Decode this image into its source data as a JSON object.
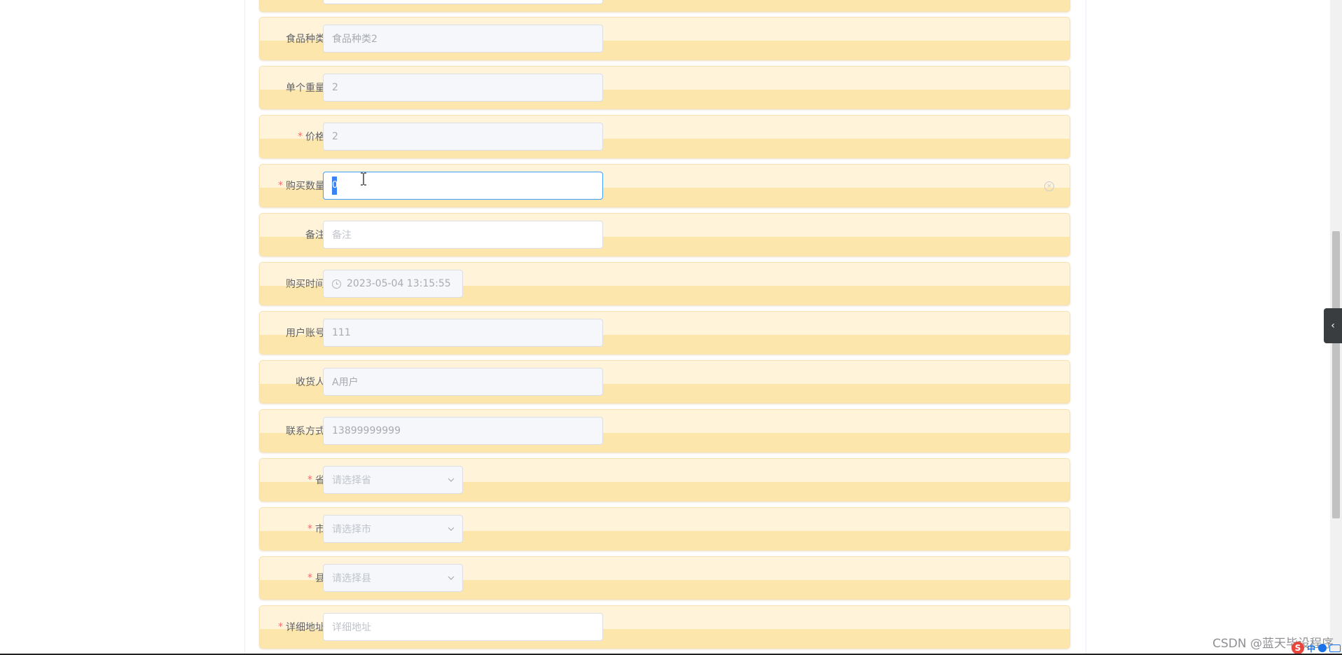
{
  "form": {
    "fields": [
      {
        "label": "食品种类",
        "required": false,
        "value": "食品种类2",
        "type": "text",
        "state": "disabled"
      },
      {
        "label": "单个重量",
        "required": false,
        "value": "2",
        "type": "text",
        "state": "disabled"
      },
      {
        "label": "价格",
        "required": true,
        "value": "2",
        "type": "text",
        "state": "disabled"
      },
      {
        "label": "购买数量",
        "required": true,
        "value": "0",
        "type": "number",
        "state": "focused"
      },
      {
        "label": "备注",
        "required": false,
        "placeholder": "备注",
        "type": "text",
        "state": "empty"
      },
      {
        "label": "购买时间",
        "required": false,
        "value": "2023-05-04 13:15:55",
        "type": "datetime",
        "state": "disabled"
      },
      {
        "label": "用户账号",
        "required": false,
        "value": "111",
        "type": "text",
        "state": "disabled"
      },
      {
        "label": "收货人",
        "required": false,
        "value": "A用户",
        "type": "text",
        "state": "disabled"
      },
      {
        "label": "联系方式",
        "required": false,
        "value": "13899999999",
        "type": "text",
        "state": "disabled"
      },
      {
        "label": "省",
        "required": true,
        "placeholder": "请选择省",
        "type": "select",
        "state": "empty"
      },
      {
        "label": "市",
        "required": true,
        "placeholder": "请选择市",
        "type": "select",
        "state": "empty"
      },
      {
        "label": "县",
        "required": true,
        "placeholder": "请选择县",
        "type": "select",
        "state": "empty"
      },
      {
        "label": "详细地址",
        "required": true,
        "placeholder": "详细地址",
        "type": "text",
        "state": "empty"
      }
    ],
    "required_mark": "*"
  },
  "icons": {
    "clock": "clock-icon",
    "select_caret": "chevron-down-icon",
    "clear": "circle-close-icon",
    "side_toggle": "chevron-left-icon"
  },
  "watermark": "CSDN @蓝天毕设程序",
  "taskbar": {
    "ime": "中"
  },
  "colors": {
    "row_top": "#fff3d9",
    "row_bottom": "#fde6ab",
    "required": "#f56c6c",
    "selection": "#3b82f6"
  }
}
